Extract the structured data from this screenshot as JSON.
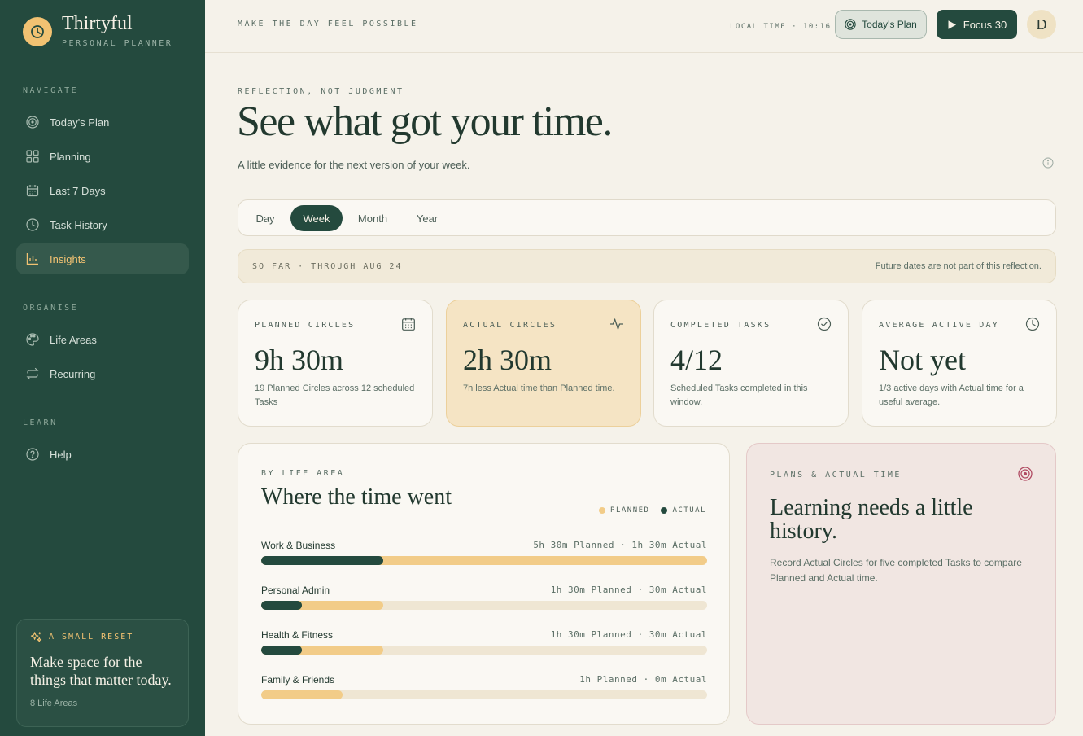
{
  "brand": {
    "name": "Thirtyful",
    "subtitle": "PERSONAL PLANNER"
  },
  "sidebar": {
    "sections": [
      {
        "label": "NAVIGATE"
      },
      {
        "label": "ORGANISE"
      },
      {
        "label": "LEARN"
      }
    ],
    "items": [
      {
        "label": "Today's Plan",
        "icon": "target-icon"
      },
      {
        "label": "Planning",
        "icon": "grid-icon"
      },
      {
        "label": "Last 7 Days",
        "icon": "calendar-icon"
      },
      {
        "label": "Task History",
        "icon": "clock-icon"
      },
      {
        "label": "Insights",
        "icon": "bar-chart-icon",
        "active": true
      },
      {
        "label": "Life Areas",
        "icon": "palette-icon"
      },
      {
        "label": "Recurring",
        "icon": "repeat-icon"
      },
      {
        "label": "Help",
        "icon": "help-icon"
      }
    ],
    "reset_card": {
      "label": "A SMALL RESET",
      "title": "Make space for the things that matter today.",
      "footer": "8 Life Areas"
    }
  },
  "topbar": {
    "tagline": "MAKE THE DAY FEEL POSSIBLE",
    "local_time": "LOCAL TIME · 10:16",
    "plan_button": "Today's Plan",
    "focus_button": "Focus 30",
    "avatar_initial": "D"
  },
  "hero": {
    "eyebrow": "REFLECTION, NOT JUDGMENT",
    "title": "See what got your time.",
    "subtitle": "A little evidence for the next version of your week."
  },
  "tabs": [
    {
      "label": "Day"
    },
    {
      "label": "Week",
      "active": true
    },
    {
      "label": "Month"
    },
    {
      "label": "Year"
    }
  ],
  "notice": {
    "left": "SO FAR · THROUGH AUG 24",
    "right": "Future dates are not part of this reflection."
  },
  "stats": [
    {
      "label": "PLANNED CIRCLES",
      "value": "9h 30m",
      "desc": "19 Planned Circles across 12 scheduled Tasks",
      "icon": "calendar-icon"
    },
    {
      "label": "ACTUAL CIRCLES",
      "value": "2h 30m",
      "desc": "7h less Actual time than Planned time.",
      "icon": "pulse-icon"
    },
    {
      "label": "COMPLETED TASKS",
      "value": "4/12",
      "desc": "Scheduled Tasks completed in this window.",
      "icon": "check-circle-icon"
    },
    {
      "label": "AVERAGE ACTIVE DAY",
      "value": "Not yet",
      "desc": "1/3 active days with Actual time for a useful average.",
      "icon": "clock-icon"
    }
  ],
  "life_area_panel": {
    "eyebrow": "BY LIFE AREA",
    "title": "Where the time went",
    "legend": {
      "planned": "PLANNED",
      "actual": "ACTUAL"
    },
    "rows": [
      {
        "name": "Work & Business",
        "values_text": "5h 30m Planned · 1h 30m Actual",
        "planned_fraction": 1.0,
        "actual_fraction": 0.273
      },
      {
        "name": "Personal Admin",
        "values_text": "1h 30m Planned · 30m Actual",
        "planned_fraction": 0.273,
        "actual_fraction": 0.091
      },
      {
        "name": "Health & Fitness",
        "values_text": "1h 30m Planned · 30m Actual",
        "planned_fraction": 0.273,
        "actual_fraction": 0.091
      },
      {
        "name": "Family & Friends",
        "values_text": "1h Planned · 0m Actual",
        "planned_fraction": 0.182,
        "actual_fraction": 0
      }
    ]
  },
  "history_panel": {
    "eyebrow": "PLANS & ACTUAL TIME",
    "title": "Learning needs a little history.",
    "desc": "Record Actual Circles for five completed Tasks to compare Planned and Actual time."
  },
  "colors": {
    "sidebar": "#244a3e",
    "accent": "#f2c272",
    "planned": "#f2cc88",
    "actual": "#244a3e",
    "history_bg": "#f1e6e2"
  }
}
